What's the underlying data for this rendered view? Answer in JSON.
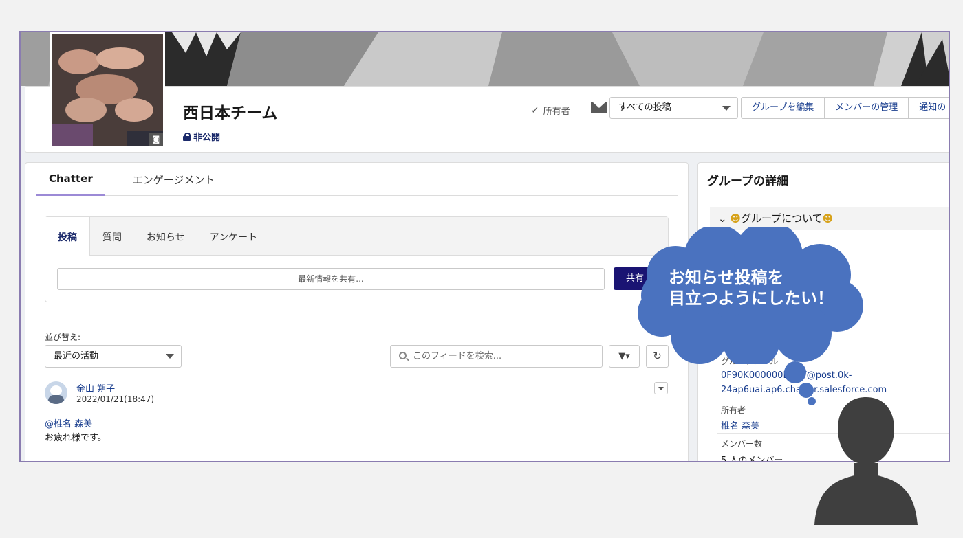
{
  "group": {
    "title": "西日本チーム",
    "privacy": "非公開"
  },
  "header_actions": {
    "owner_label": "所有者",
    "post_filter": "すべての投稿",
    "buttons": [
      "グループを編集",
      "メンバーの管理",
      "通知の"
    ]
  },
  "main_tabs": [
    "Chatter",
    "エンゲージメント"
  ],
  "publisher": {
    "tabs": [
      "投稿",
      "質問",
      "お知らせ",
      "アンケート"
    ],
    "placeholder": "最新情報を共有...",
    "share_button": "共有"
  },
  "feed": {
    "sort_label": "並び替え:",
    "sort_value": "最近の活動",
    "search_placeholder": "このフィードを検索..."
  },
  "post": {
    "author": "金山 朔子",
    "date": "2022/01/21(18:47)",
    "mention": "@椎名 森美",
    "body": "お疲れ様です。"
  },
  "details": {
    "title": "グループの詳細",
    "about": "グループについて",
    "email_label": "グループメール",
    "email_line1": "0F90K000000DSAY@post.0k-",
    "email_line2": "24ap6uai.ap6.chatter.salesforce.com",
    "owner_label": "所有者",
    "owner_value": "椎名 森美",
    "members_label": "メンバー数",
    "members_value": "5 人のメンバー"
  },
  "thought": {
    "line1": "お知らせ投稿を",
    "line2": "目立つようにしたい！"
  },
  "colors": {
    "accent": "#1a1473",
    "link": "#1b3f8f",
    "cloud": "#4a72bf",
    "tab_underline": "#9c8ad6"
  }
}
